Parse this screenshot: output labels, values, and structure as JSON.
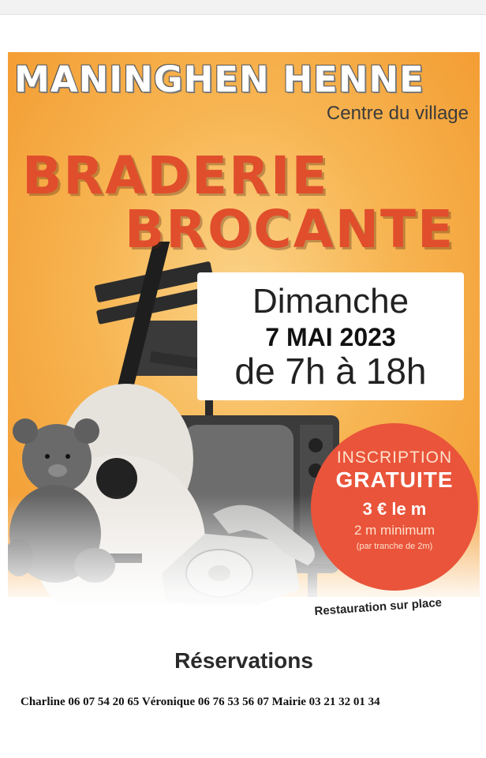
{
  "poster": {
    "town": "MANINGHEN HENNE",
    "location": "Centre du village",
    "title_line1": "BRADERIE",
    "title_line2": "BROCANTE",
    "day": "Dimanche",
    "date": "7 MAI 2023",
    "hours": "de 7h à 18h",
    "inscription": {
      "line1": "INSCRIPTION",
      "line2": "GRATUITE",
      "line3": "3 € le m",
      "line4": "2 m minimum",
      "line5": "(par tranche de 2m)"
    },
    "restauration": "Restauration sur place",
    "reservations_title": "Réservations",
    "contacts": "Charline 06 07 54 20 65   Véronique 06 76 53 56 07   Mairie 03 21 32 01 34"
  },
  "colors": {
    "orange": "#f7b552",
    "title_red": "#e04e2c",
    "circle_red": "#e9543a"
  },
  "illustration": [
    "director-chair",
    "acoustic-guitar",
    "teddy-bear",
    "crt-television",
    "rotary-telephone"
  ]
}
